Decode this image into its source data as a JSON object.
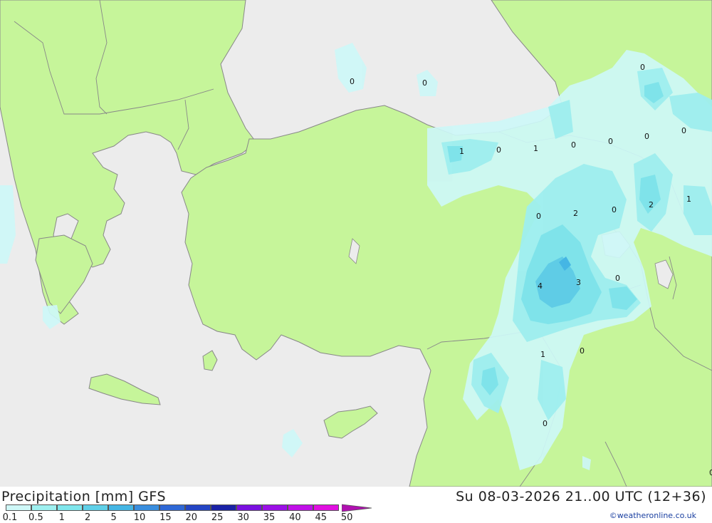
{
  "title": "Precipitation [mm] GFS",
  "datetime": "Su 08-03-2026 21..00 UTC (12+36)",
  "credit": "©weatheronline.co.uk",
  "colors": {
    "land": "#c6f59a",
    "sea": "#ececec",
    "border": "#888888",
    "precip_0_1": "#cdf7f7",
    "precip_0_5": "#9eeeee",
    "precip_1": "#7fe3ea",
    "precip_2": "#5fcce6"
  },
  "legend": {
    "labels": [
      "0.1",
      "0.5",
      "1",
      "2",
      "5",
      "10",
      "15",
      "20",
      "25",
      "30",
      "35",
      "40",
      "45",
      "50"
    ],
    "colors": [
      "#cff8f8",
      "#9ef0f0",
      "#7fe6ec",
      "#5fd0e8",
      "#45b6e4",
      "#3a8ede",
      "#2f68d6",
      "#2445c4",
      "#1a22a6",
      "#7a10e0",
      "#9b10e6",
      "#c010e8",
      "#e010e0",
      "#b010b0"
    ]
  },
  "value_labels": [
    "0",
    "0",
    "0",
    "1",
    "0",
    "1",
    "0",
    "0",
    "0",
    "0",
    "0",
    "2",
    "0",
    "2",
    "1",
    "4",
    "3",
    "0",
    "1",
    "0",
    "0",
    "0"
  ]
}
